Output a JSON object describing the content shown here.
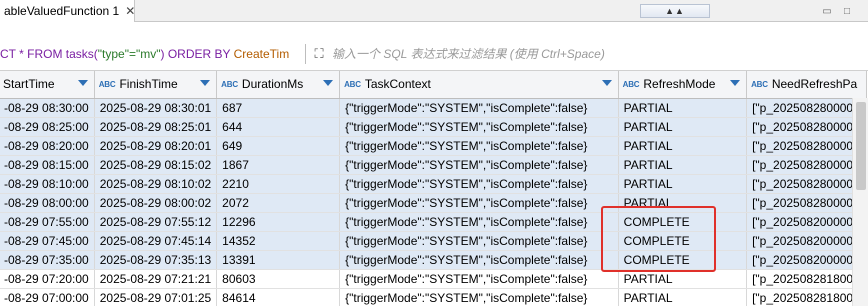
{
  "tab": {
    "title": "ableValuedFunction 1",
    "close": "✕"
  },
  "sql": {
    "part1": "CT * FROM tasks(",
    "part2": "\"type\"=\"mv\"",
    "part3": ") ORDER BY ",
    "part4": "CreateTim"
  },
  "filter": {
    "placeholder": "输入一个 SQL 表达式来过滤结果 (使用 Ctrl+Space)"
  },
  "columns": [
    {
      "label": "StartTime",
      "abc": ""
    },
    {
      "label": "FinishTime",
      "abc": "ABC"
    },
    {
      "label": "DurationMs",
      "abc": "ABC"
    },
    {
      "label": "TaskContext",
      "abc": "ABC"
    },
    {
      "label": "RefreshMode",
      "abc": "ABC"
    },
    {
      "label": "NeedRefreshPa",
      "abc": "ABC"
    }
  ],
  "rows": [
    [
      "-08-29 08:30:00",
      "2025-08-29 08:30:01",
      "687",
      "{\"triggerMode\":\"SYSTEM\",\"isComplete\":false}",
      "PARTIAL",
      "[\"p_2025082800000"
    ],
    [
      "-08-29 08:25:00",
      "2025-08-29 08:25:01",
      "644",
      "{\"triggerMode\":\"SYSTEM\",\"isComplete\":false}",
      "PARTIAL",
      "[\"p_2025082800000"
    ],
    [
      "-08-29 08:20:00",
      "2025-08-29 08:20:01",
      "649",
      "{\"triggerMode\":\"SYSTEM\",\"isComplete\":false}",
      "PARTIAL",
      "[\"p_2025082800000"
    ],
    [
      "-08-29 08:15:00",
      "2025-08-29 08:15:02",
      "1867",
      "{\"triggerMode\":\"SYSTEM\",\"isComplete\":false}",
      "PARTIAL",
      "[\"p_2025082800000"
    ],
    [
      "-08-29 08:10:00",
      "2025-08-29 08:10:02",
      "2210",
      "{\"triggerMode\":\"SYSTEM\",\"isComplete\":false}",
      "PARTIAL",
      "[\"p_2025082800000"
    ],
    [
      "-08-29 08:00:00",
      "2025-08-29 08:00:02",
      "2072",
      "{\"triggerMode\":\"SYSTEM\",\"isComplete\":false}",
      "PARTIAL",
      "[\"p_2025082800000"
    ],
    [
      "-08-29 07:55:00",
      "2025-08-29 07:55:12",
      "12296",
      "{\"triggerMode\":\"SYSTEM\",\"isComplete\":false}",
      "COMPLETE",
      "[\"p_2025082000000"
    ],
    [
      "-08-29 07:45:00",
      "2025-08-29 07:45:14",
      "14352",
      "{\"triggerMode\":\"SYSTEM\",\"isComplete\":false}",
      "COMPLETE",
      "[\"p_2025082000000"
    ],
    [
      "-08-29 07:35:00",
      "2025-08-29 07:35:13",
      "13391",
      "{\"triggerMode\":\"SYSTEM\",\"isComplete\":false}",
      "COMPLETE",
      "[\"p_2025082000000"
    ],
    [
      "-08-29 07:20:00",
      "2025-08-29 07:21:21",
      "80603",
      "{\"triggerMode\":\"SYSTEM\",\"isComplete\":false}",
      "PARTIAL",
      "[\"p_2025082818000"
    ],
    [
      "-08-29 07:00:00",
      "2025-08-29 07:01:25",
      "84614",
      "{\"triggerMode\":\"SYSTEM\",\"isComplete\":false}",
      "PARTIAL",
      "[\"p_2025082818000"
    ]
  ],
  "selected_rows": [
    0,
    1,
    2,
    3,
    4,
    5,
    6,
    7,
    8
  ],
  "colors": {
    "selection": "#dfe9f5",
    "highlight": "#e0302a",
    "header_icon": "#2d6fb5"
  }
}
